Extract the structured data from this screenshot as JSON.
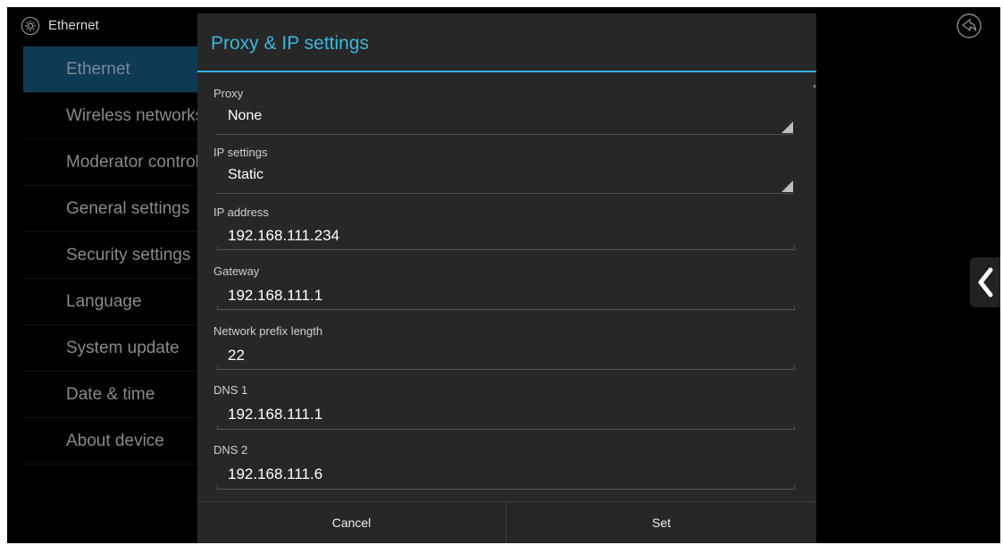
{
  "topbar": {
    "title": "Ethernet"
  },
  "sidebar": {
    "items": [
      {
        "label": "Ethernet"
      },
      {
        "label": "Wireless networks"
      },
      {
        "label": "Moderator control"
      },
      {
        "label": "General settings"
      },
      {
        "label": "Security settings"
      },
      {
        "label": "Language"
      },
      {
        "label": "System update"
      },
      {
        "label": "Date & time"
      },
      {
        "label": "About device"
      }
    ],
    "selected_index": 0
  },
  "dialog": {
    "title": "Proxy & IP settings",
    "proxy": {
      "label": "Proxy",
      "value": "None"
    },
    "ip_settings": {
      "label": "IP settings",
      "value": "Static"
    },
    "ip_address": {
      "label": "IP address",
      "value": "192.168.111.234"
    },
    "gateway": {
      "label": "Gateway",
      "value": "192.168.111.1"
    },
    "prefix_length": {
      "label": "Network prefix length",
      "value": "22"
    },
    "dns1": {
      "label": "DNS 1",
      "value": "192.168.111.1"
    },
    "dns2": {
      "label": "DNS 2",
      "value": "192.168.111.6"
    },
    "cancel_label": "Cancel",
    "set_label": "Set"
  },
  "colors": {
    "accent": "#33b5e5",
    "background": "#000000",
    "dialog_bg": "#272727",
    "selected_item_bg": "#0e3a55"
  },
  "icons": {
    "settings": "gear-icon",
    "back": "back-arrow-icon",
    "collapse": "chevron-left-icon",
    "spinner": "spinner-triangle-icon"
  }
}
